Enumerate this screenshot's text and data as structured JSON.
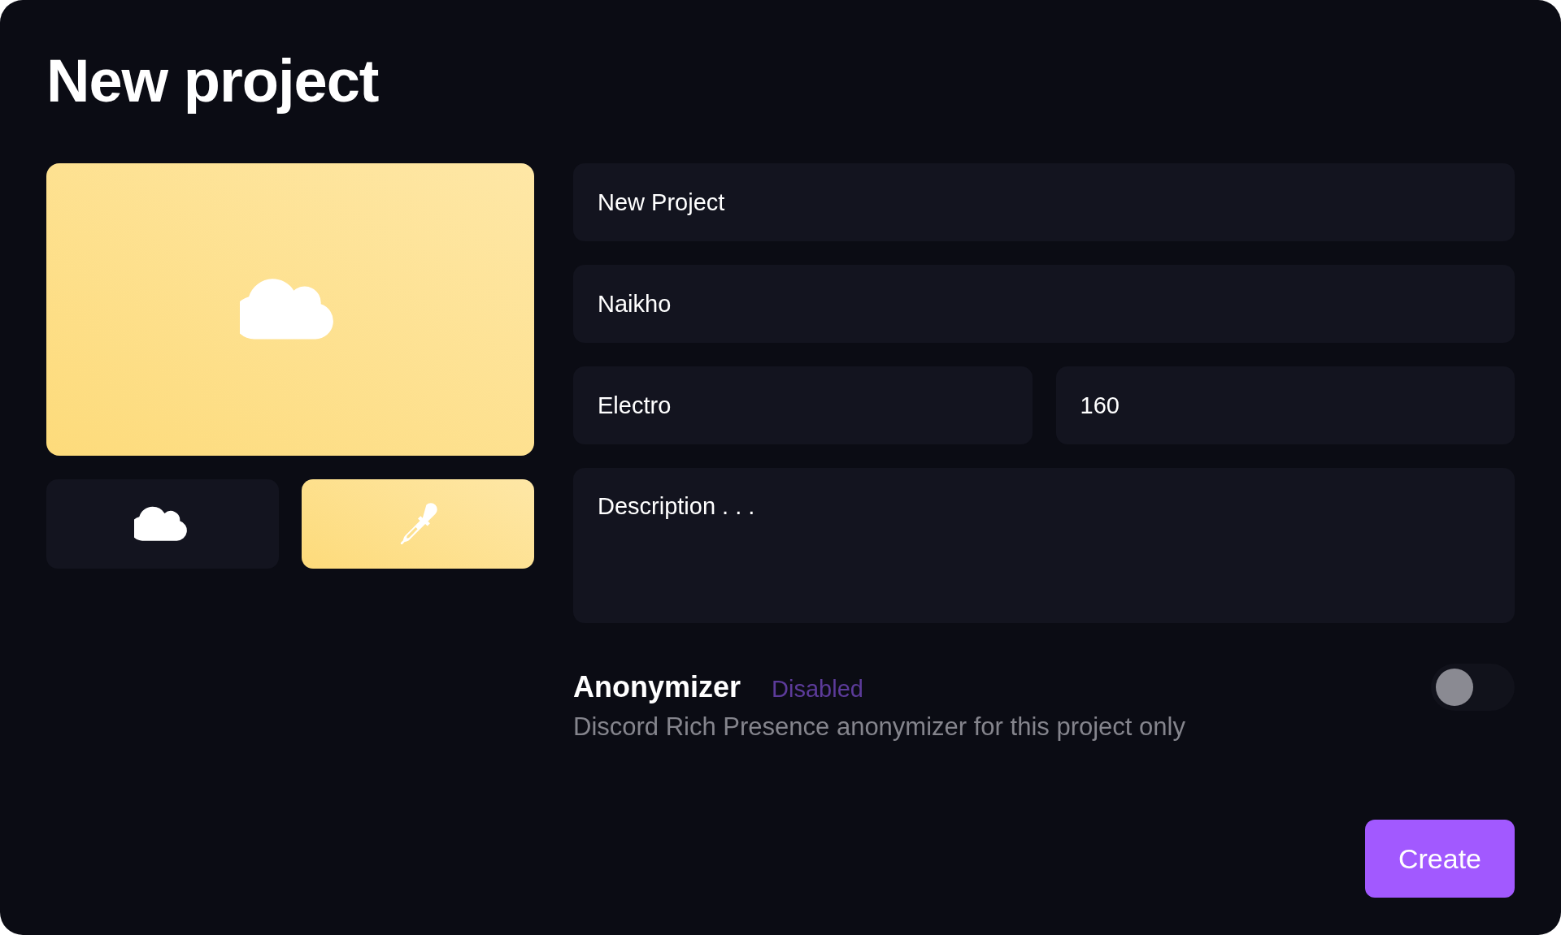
{
  "dialog": {
    "title": "New project"
  },
  "cover": {
    "kind": "gradient"
  },
  "cover_options": [
    {
      "kind": "cloud",
      "selected": false
    },
    {
      "kind": "eyedropper",
      "selected": true
    }
  ],
  "fields": [
    {
      "kind": "text",
      "value": "New Project"
    },
    {
      "kind": "text",
      "value": "Naikho"
    },
    {
      "kind": "pair",
      "items": [
        {
          "value": "Electro"
        },
        {
          "value": "160"
        }
      ]
    },
    {
      "kind": "textarea",
      "placeholder": "Description . . ."
    }
  ],
  "anonymizer": {
    "title": "Anonymizer",
    "status": "Disabled",
    "description": "Discord Rich Presence anonymizer for this project only",
    "on": false
  },
  "buttons": [
    {
      "label": "Create"
    }
  ]
}
